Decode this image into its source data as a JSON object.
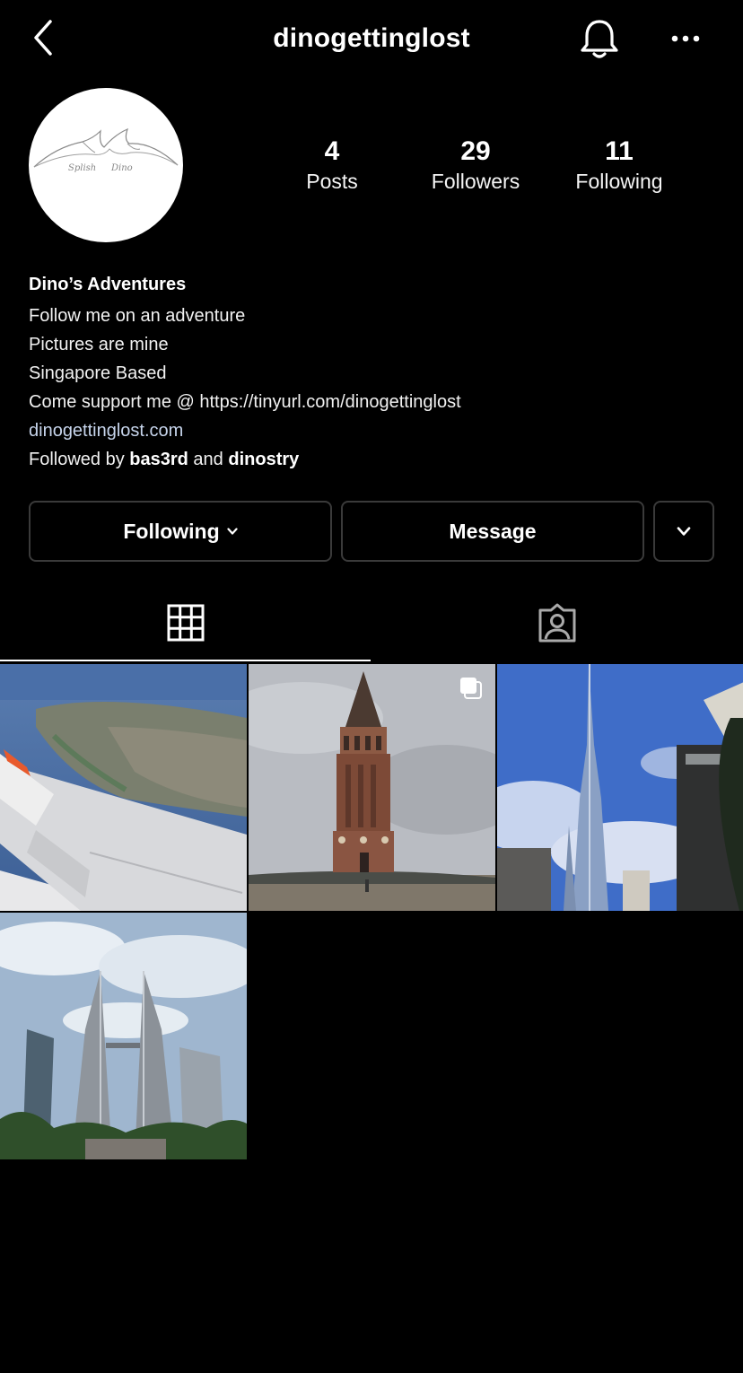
{
  "header": {
    "username": "dinogettinglost",
    "back_icon": "chevron-left-icon",
    "notification_icon": "bell-icon",
    "more_icon": "ellipsis-icon"
  },
  "profile": {
    "avatar_icon": "avatar-logo",
    "stats": [
      {
        "count": "4",
        "label": "Posts"
      },
      {
        "count": "29",
        "label": "Followers"
      },
      {
        "count": "11",
        "label": "Following"
      }
    ]
  },
  "bio": {
    "name": "Dino’s Adventures",
    "lines": [
      "Follow me on an adventure",
      "Pictures are mine",
      "Singapore Based",
      "Come support me @ https://tinyurl.com/dinogettinglost"
    ],
    "website": "dinogettinglost.com",
    "followed_by_prefix": "Followed by ",
    "followed_by_user1": "bas3rd",
    "followed_by_and": " and ",
    "followed_by_user2": "dinostry"
  },
  "actions": {
    "following_label": "Following",
    "message_label": "Message"
  },
  "tabs": {
    "grid_icon": "grid-icon",
    "tagged_icon": "tagged-icon"
  },
  "posts": [
    {
      "subject": "airplane wing over coastline",
      "multi": false
    },
    {
      "subject": "brick clock tower",
      "multi": true
    },
    {
      "subject": "Burj Khalifa skyscraper",
      "multi": false
    },
    {
      "subject": "Petronas twin towers",
      "multi": false
    }
  ],
  "colors": {
    "background": "#000000",
    "text": "#ffffff",
    "link": "#c7d5ec",
    "button_border": "#3a3a3a"
  }
}
